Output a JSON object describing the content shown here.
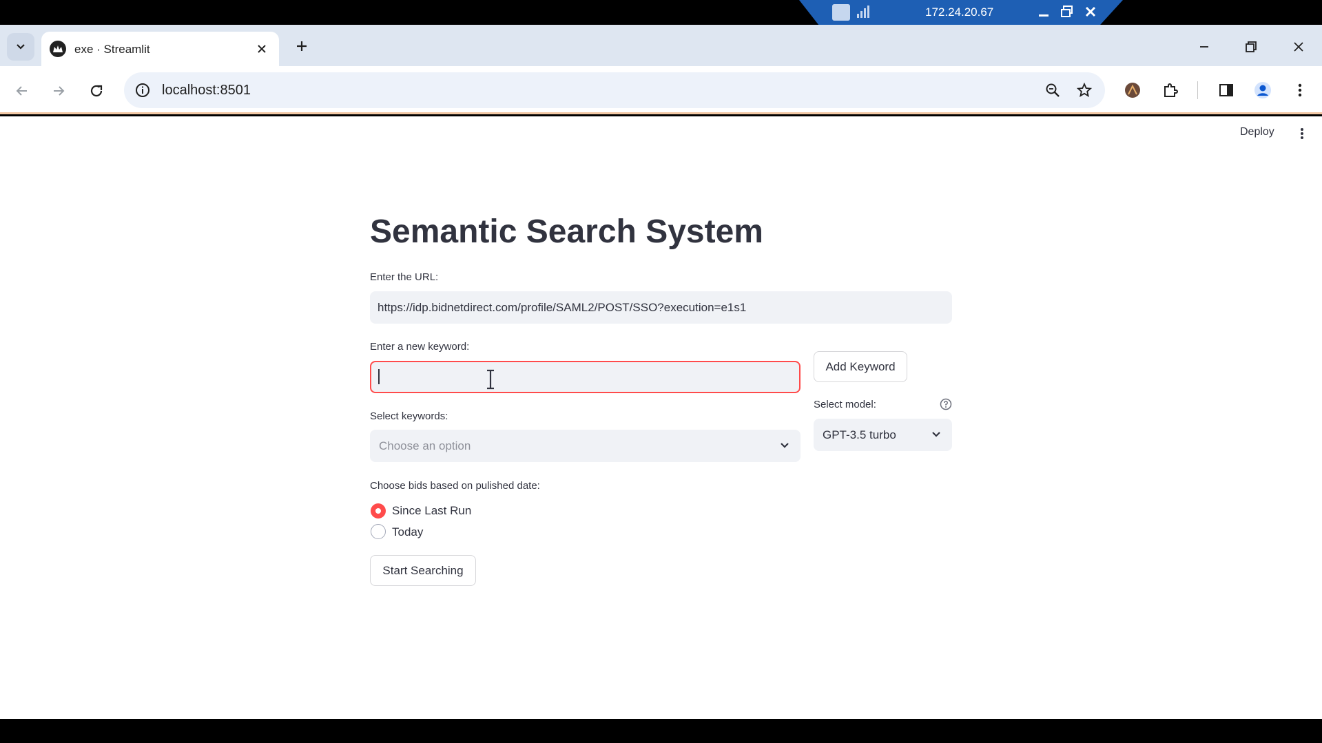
{
  "browser": {
    "tab_title": "exe · Streamlit",
    "url": "localhost:8501"
  },
  "remote_session": {
    "ip": "172.24.20.67"
  },
  "app": {
    "deploy_label": "Deploy",
    "title": "Semantic Search System",
    "url_label": "Enter the URL:",
    "url_value": "https://idp.bidnetdirect.com/profile/SAML2/POST/SSO?execution=e1s1",
    "keyword_label": "Enter a new keyword:",
    "keyword_value": "",
    "add_keyword_label": "Add Keyword",
    "keywords_label": "Select keywords:",
    "keywords_placeholder": "Choose an option",
    "model_label": "Select model:",
    "model_value": "GPT-3.5 turbo",
    "date_label": "Choose bids based on pulished date:",
    "radio_options": [
      "Since Last Run",
      "Today"
    ],
    "radio_selected": "Since Last Run",
    "start_label": "Start Searching"
  },
  "colors": {
    "accent": "#ff4b4b",
    "input_bg": "#f0f2f6",
    "text": "#31333f",
    "remote_bar": "#1e5fb4"
  }
}
